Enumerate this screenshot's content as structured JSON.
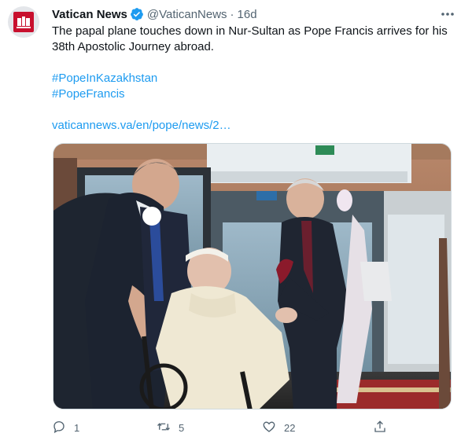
{
  "tweet": {
    "author_name": "Vatican News",
    "handle": "@VaticanNews",
    "separator": "·",
    "time": "16d",
    "text_line1": "The papal plane touches down in Nur-Sultan as Pope Francis arrives for his 38th Apostolic Journey abroad.",
    "hashtag1": "#PopeInKazakhstan",
    "hashtag2": "#PopeFrancis",
    "link": "vaticannews.va/en/pope/news/2…",
    "replies": "1",
    "retweets": "5",
    "likes": "22"
  },
  "colors": {
    "link": "#1d9bf0",
    "verified": "#1d9bf0",
    "brand": "#c8102e"
  },
  "icons": [
    "verified-badge-icon",
    "more-icon",
    "reply-icon",
    "retweet-icon",
    "like-icon",
    "share-icon"
  ]
}
